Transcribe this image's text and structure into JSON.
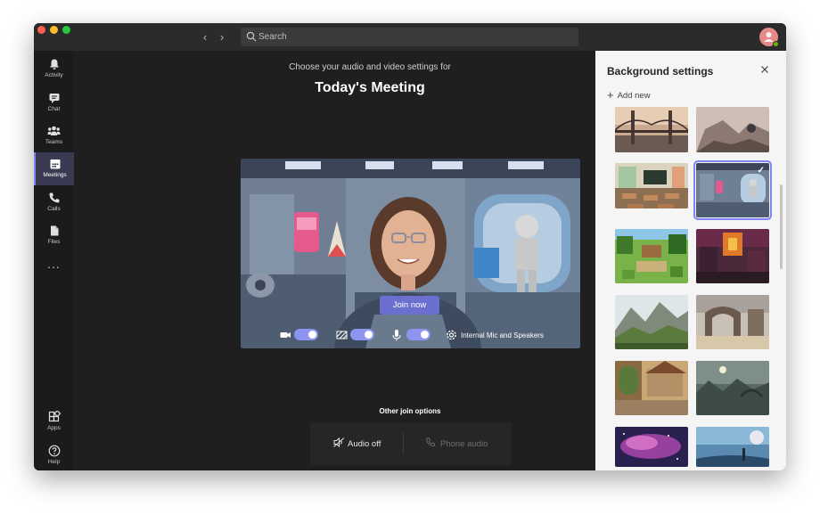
{
  "search": {
    "placeholder": "Search"
  },
  "rail": {
    "items": [
      {
        "label": "Activity",
        "icon": "bell-icon"
      },
      {
        "label": "Chat",
        "icon": "chat-icon"
      },
      {
        "label": "Teams",
        "icon": "teams-icon"
      },
      {
        "label": "Meetings",
        "icon": "calendar-icon"
      },
      {
        "label": "Calls",
        "icon": "phone-icon"
      },
      {
        "label": "Files",
        "icon": "file-icon"
      }
    ],
    "more": "...",
    "bottom": [
      {
        "label": "Apps",
        "icon": "apps-icon"
      },
      {
        "label": "Help",
        "icon": "help-icon"
      }
    ],
    "active": "Meetings"
  },
  "meeting": {
    "subtitle": "Choose your audio and video settings for",
    "title": "Today's Meeting",
    "join_label": "Join now",
    "device_label": "Internal Mic and Speakers",
    "other_join_label": "Other join options",
    "audio_off_label": "Audio off",
    "phone_audio_label": "Phone audio"
  },
  "panel": {
    "title": "Background settings",
    "add_new_label": "Add new",
    "selected_index": 3,
    "thumbnails": [
      {
        "name": "golden-gate-bridge-bg"
      },
      {
        "name": "rocky-arch-bg"
      },
      {
        "name": "classroom-bg"
      },
      {
        "name": "space-station-bg"
      },
      {
        "name": "minecraft-village-bg"
      },
      {
        "name": "minecraft-nether-bg"
      },
      {
        "name": "mountain-valley-bg"
      },
      {
        "name": "stone-ruins-bg"
      },
      {
        "name": "fantasy-village-bg"
      },
      {
        "name": "alien-landscape-bg"
      },
      {
        "name": "nebula-bg"
      },
      {
        "name": "planet-horizon-bg"
      }
    ]
  },
  "colors": {
    "accent": "#7f85f5",
    "join_button": "#6b6fcf",
    "panel_bg": "#f5f5f5",
    "app_bg": "#1f1f1f"
  }
}
